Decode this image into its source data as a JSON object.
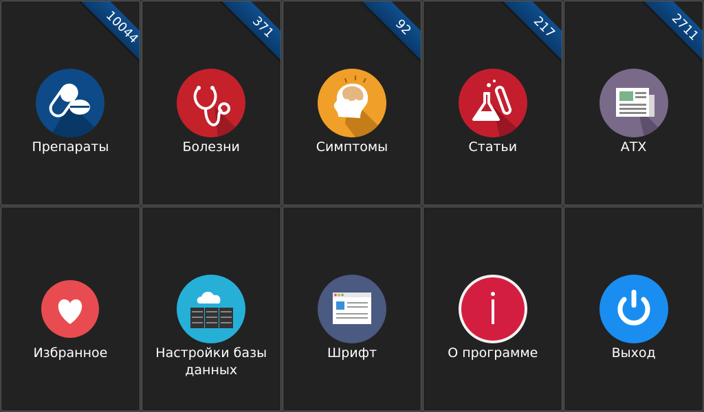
{
  "tiles": [
    {
      "label": "Препараты",
      "count": "10044",
      "icon": "pills-icon",
      "color": "#0d4a87"
    },
    {
      "label": "Болезни",
      "count": "371",
      "icon": "stethoscope-icon",
      "color": "#c4212b"
    },
    {
      "label": "Симптомы",
      "count": "92",
      "icon": "head-brain-icon",
      "color": "#f0a028"
    },
    {
      "label": "Статьи",
      "count": "217",
      "icon": "flask-icon",
      "color": "#c41e2e"
    },
    {
      "label": "АТХ",
      "count": "2711",
      "icon": "newspaper-icon",
      "color": "#7a6a8a"
    },
    {
      "label": "Избранное",
      "icon": "heart-icon",
      "color": "#e84c50"
    },
    {
      "label": "Настройки базы данных",
      "icon": "cloud-server-icon",
      "color": "#26b0d8"
    },
    {
      "label": "Шрифт",
      "icon": "window-icon",
      "color": "#4a5a80"
    },
    {
      "label": "О программе",
      "icon": "info-icon",
      "color": "#d41e40"
    },
    {
      "label": "Выход",
      "icon": "power-icon",
      "color": "#1a8ef0"
    }
  ]
}
